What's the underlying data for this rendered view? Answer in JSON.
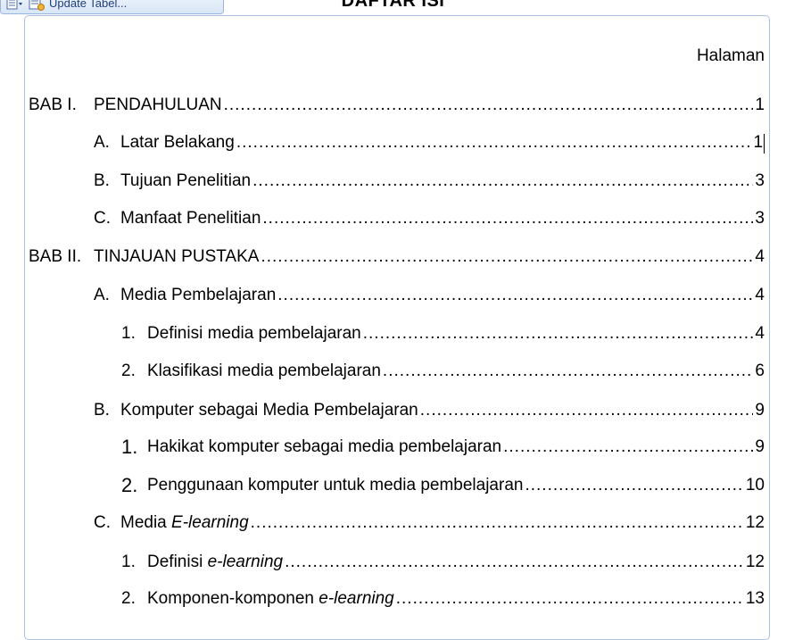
{
  "toolbar": {
    "update_label": "Update Tabel..."
  },
  "title": "DAFTAR ISI",
  "page_column_label": "Halaman",
  "entries": [
    {
      "num": "BAB I.",
      "text": "PENDAHULUAN",
      "page": "1"
    },
    {
      "num": "A.",
      "text": "Latar Belakang",
      "page": "1"
    },
    {
      "num": "B.",
      "text": "Tujuan Penelitian",
      "page": "3"
    },
    {
      "num": "C.",
      "text": "Manfaat Penelitian",
      "page": "3"
    },
    {
      "num": "BAB II.",
      "text": "TINJAUAN PUSTAKA",
      "page": "4"
    },
    {
      "num": "A.",
      "text": "Media Pembelajaran",
      "page": "4"
    },
    {
      "num": "1.",
      "text": "Definisi media pembelajaran",
      "page": "4"
    },
    {
      "num": "2.",
      "text": "Klasifikasi media pembelajaran",
      "page": "6"
    },
    {
      "num": "B.",
      "text": "Komputer sebagai Media Pembelajaran",
      "page": "9"
    },
    {
      "num": "1.",
      "text": "Hakikat komputer sebagai media pembelajaran",
      "page": "9"
    },
    {
      "num": "2.",
      "text": "Penggunaan komputer untuk media pembelajaran",
      "page": "10"
    },
    {
      "num": "C.",
      "text_pre": "Media ",
      "text_em": "E-learning",
      "page": "12"
    },
    {
      "num": "1.",
      "text_pre": "Definisi ",
      "text_em": "e-learning",
      "page": "12"
    },
    {
      "num": "2.",
      "text_pre": "Komponen-komponen ",
      "text_em": "e-learning",
      "page": "13"
    }
  ]
}
